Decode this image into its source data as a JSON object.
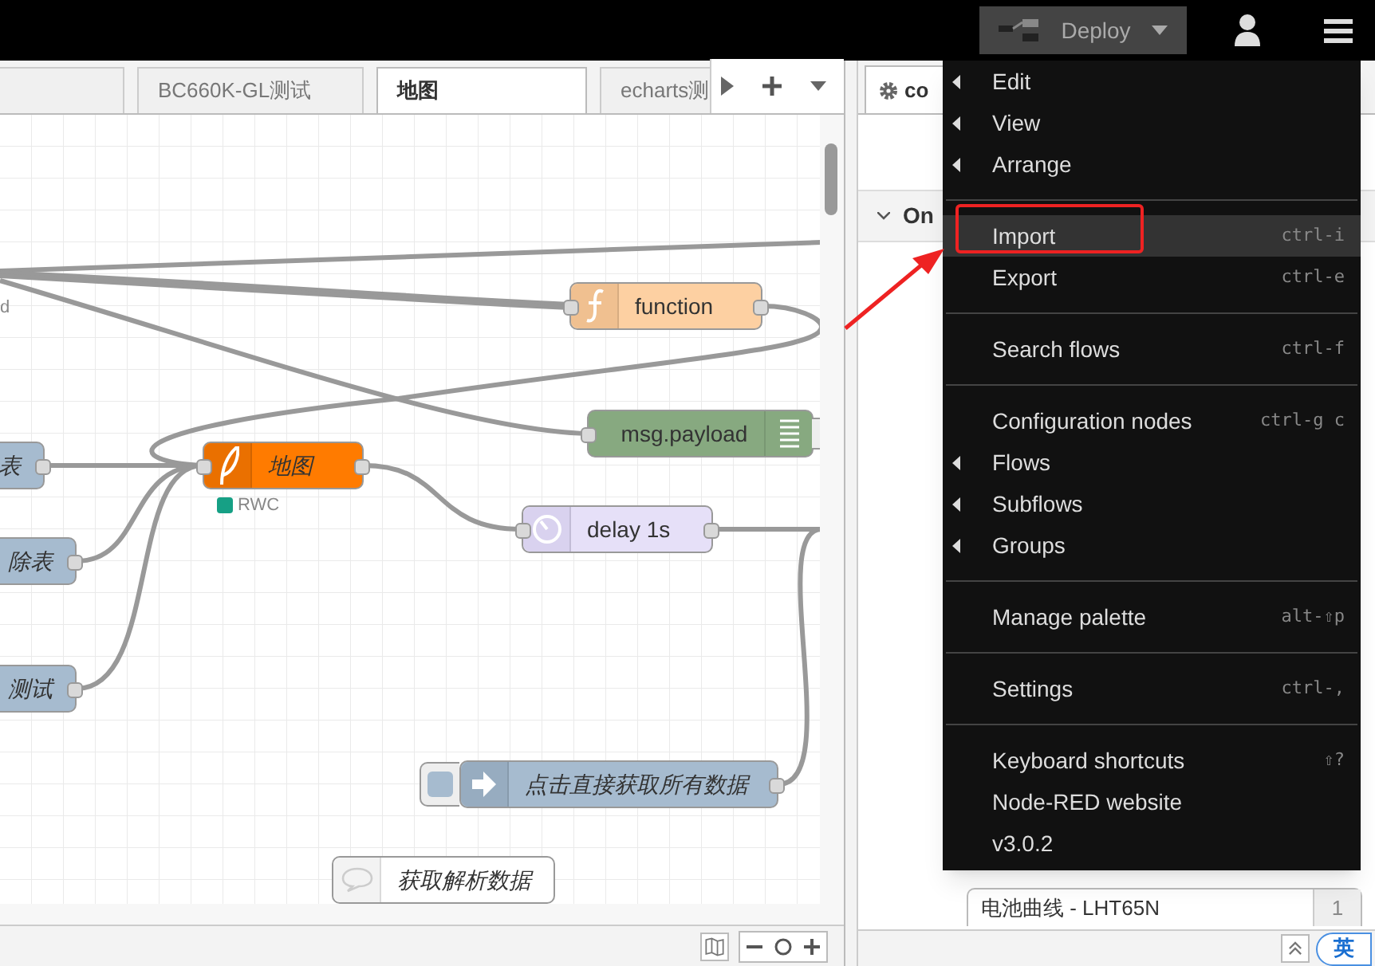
{
  "header": {
    "deploy": "Deploy"
  },
  "tabs": [
    {
      "selected": false
    },
    {
      "label": "BC660K-GL测试",
      "selected": false
    },
    {
      "label": "地图",
      "selected": true
    },
    {
      "label": "echarts测",
      "selected": false
    }
  ],
  "nodes": [
    {
      "kind": "label",
      "label": "d"
    },
    {
      "kind": "function",
      "label": "function"
    },
    {
      "kind": "debug",
      "label": "msg.payload"
    },
    {
      "kind": "link",
      "label": "表"
    },
    {
      "kind": "worldmap",
      "label": "地图",
      "status": {
        "text": "RWC",
        "color": "#16a085"
      }
    },
    {
      "kind": "change",
      "label": "除表"
    },
    {
      "kind": "delay",
      "label": "delay 1s"
    },
    {
      "kind": "change",
      "label": "测试"
    },
    {
      "kind": "inject",
      "label": "点击直接获取所有数据"
    },
    {
      "kind": "comment",
      "label": "获取解析数据"
    }
  ],
  "sidebar": {
    "tab": "co",
    "section": "On",
    "items": [
      {
        "label": "电池曲线 - LHT65N",
        "count": "1"
      }
    ]
  },
  "menu": {
    "groups": [
      [
        {
          "label": "Edit",
          "submenu": true,
          "highlighted": false
        },
        {
          "label": "View",
          "submenu": true,
          "highlighted": false
        },
        {
          "label": "Arrange",
          "submenu": true,
          "highlighted": false
        }
      ],
      [
        {
          "label": "Import",
          "shortcut": "ctrl-i",
          "submenu": false,
          "highlighted": true
        },
        {
          "label": "Export",
          "shortcut": "ctrl-e",
          "submenu": false,
          "highlighted": false
        }
      ],
      [
        {
          "label": "Search flows",
          "shortcut": "ctrl-f",
          "submenu": false,
          "highlighted": false
        }
      ],
      [
        {
          "label": "Configuration nodes",
          "shortcut": "ctrl-g c",
          "submenu": false,
          "highlighted": false
        },
        {
          "label": "Flows",
          "submenu": true,
          "highlighted": false
        },
        {
          "label": "Subflows",
          "submenu": true,
          "highlighted": false
        },
        {
          "label": "Groups",
          "submenu": true,
          "highlighted": false
        }
      ],
      [
        {
          "label": "Manage palette",
          "shortcut": "alt-⇧p",
          "submenu": false,
          "highlighted": false
        }
      ],
      [
        {
          "label": "Settings",
          "shortcut": "ctrl-,",
          "submenu": false,
          "highlighted": false
        }
      ],
      [
        {
          "label": "Keyboard shortcuts",
          "shortcut": "⇧?",
          "submenu": false,
          "highlighted": false
        },
        {
          "label": "Node-RED website",
          "submenu": false,
          "highlighted": false
        },
        {
          "label": "v3.0.2",
          "submenu": false,
          "highlighted": false
        }
      ]
    ]
  },
  "ime": "英"
}
